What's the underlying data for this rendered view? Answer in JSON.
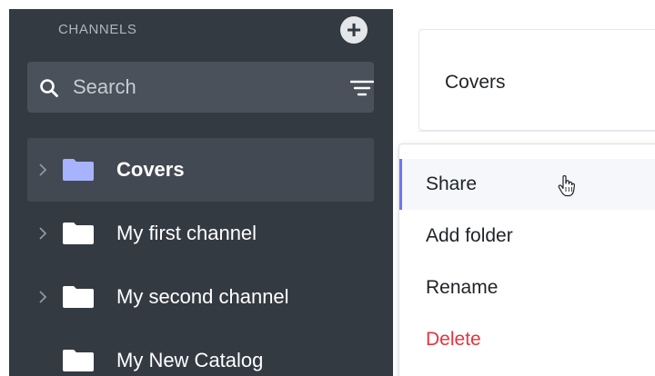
{
  "sidebar": {
    "header": "CHANNELS",
    "add_icon": "plus-circle-icon",
    "search": {
      "placeholder": "Search",
      "value": ""
    },
    "items": [
      {
        "label": "Covers",
        "active": true,
        "expandable": true,
        "folder_color": "#a7b3ff"
      },
      {
        "label": "My first channel",
        "active": false,
        "expandable": true,
        "folder_color": "#ffffff"
      },
      {
        "label": "My second channel",
        "active": false,
        "expandable": true,
        "folder_color": "#ffffff"
      },
      {
        "label": "My New Catalog",
        "active": false,
        "expandable": false,
        "folder_color": "#ffffff"
      }
    ]
  },
  "main": {
    "card_title": "Covers"
  },
  "context_menu": {
    "items": [
      {
        "label": "Share",
        "hover": true
      },
      {
        "label": "Add folder",
        "hover": false
      },
      {
        "label": "Rename",
        "hover": false
      },
      {
        "label": "Delete",
        "danger": true
      }
    ]
  },
  "colors": {
    "sidebar_bg": "#343a42",
    "accent": "#6b77f0",
    "danger": "#e5353e"
  }
}
